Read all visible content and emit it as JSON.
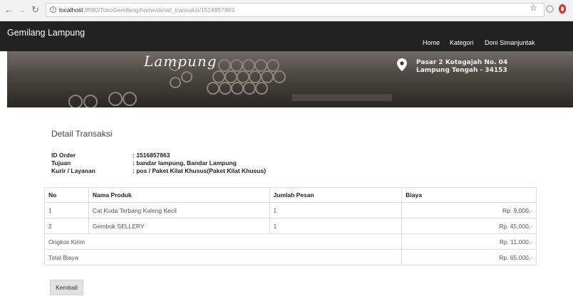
{
  "browser": {
    "url_host": "localhost",
    "url_path": ":8080/TokoGemilang/home/detail_transaksi/1516857863"
  },
  "navbar": {
    "brand": "Gemilang Lampung",
    "links": [
      "Home",
      "Kategori",
      "Doni Simanjuntak"
    ]
  },
  "banner": {
    "script_text": "Lampung",
    "address_line1": "Pasar 2 Kotagajah No. 04",
    "address_line2": "Lampung Tengah - 34153"
  },
  "page": {
    "title": "Detail Transaksi"
  },
  "order": {
    "rows": [
      {
        "label": "ID Order",
        "value": ": 1516857863"
      },
      {
        "label": "Tujuan",
        "value": ": bandar lampung, Bandar Lampung"
      },
      {
        "label": "Kurir / Layanan",
        "value": ": pos / Paket Kilat Khusus(Paket Kilat Khusus)"
      }
    ]
  },
  "table": {
    "headers": [
      "No",
      "Nama Produk",
      "Jumlah Pesan",
      "Biaya"
    ],
    "items": [
      {
        "no": "1",
        "product": "Cat Kuda Terbang Kaleng Kecil",
        "qty": "1",
        "cost": "Rp. 9.000,-"
      },
      {
        "no": "2",
        "product": "Gembok SELLERY",
        "qty": "1",
        "cost": "Rp. 45.000,-"
      }
    ],
    "shipping_label": "Ongkos Kirim",
    "shipping_cost": "Rp. 11.000,-",
    "total_label": "Total Biaya",
    "total_cost": "Rp. 65.000,-"
  },
  "actions": {
    "back_label": "Kembali"
  }
}
